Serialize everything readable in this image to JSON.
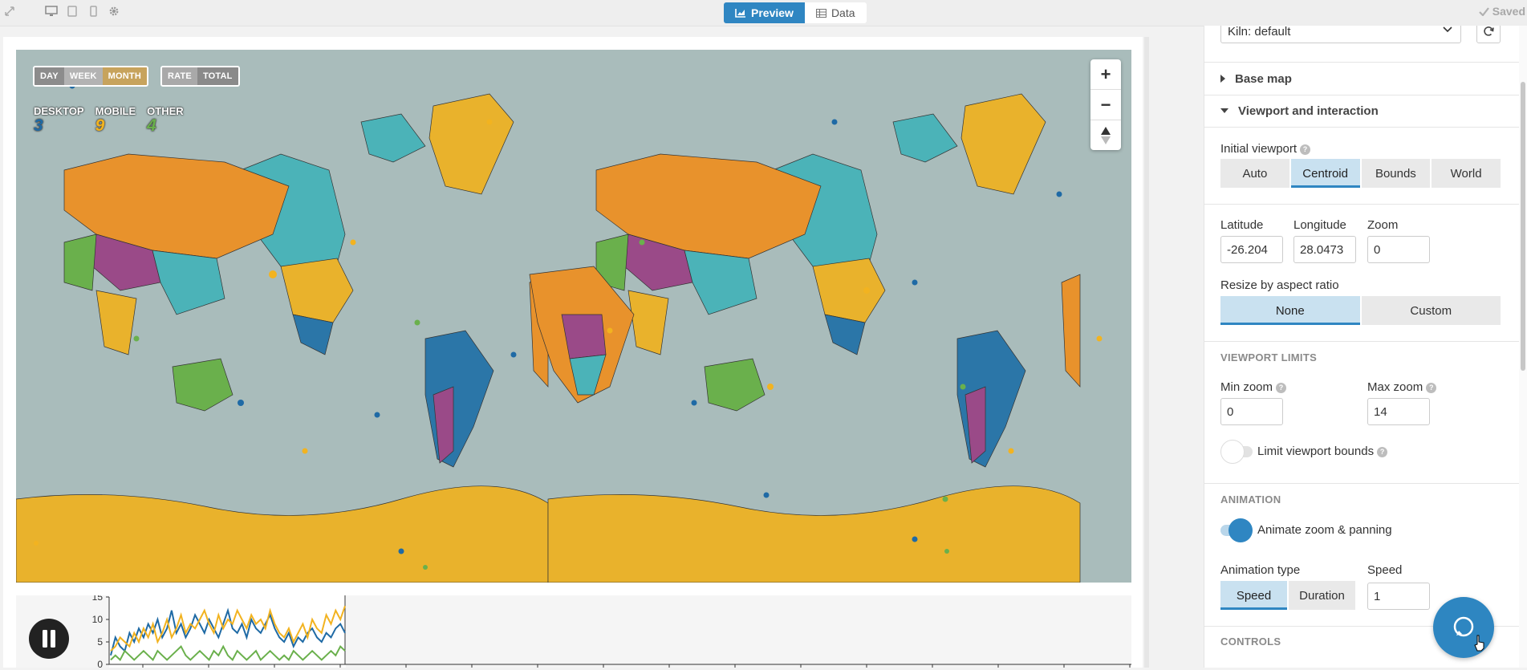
{
  "topbar": {
    "tabs": [
      {
        "label": "Preview",
        "icon": "chart-icon",
        "active": true
      },
      {
        "label": "Data",
        "icon": "table-icon",
        "active": false
      }
    ],
    "saved_label": "Saved"
  },
  "map": {
    "time_buttons": [
      "DAY",
      "WEEK",
      "MONTH"
    ],
    "mode_buttons": [
      "RATE",
      "TOTAL"
    ],
    "legend": [
      {
        "label": "DESKTOP",
        "value": "3",
        "color": "#1f6aa5"
      },
      {
        "label": "MOBILE",
        "value": "9",
        "color": "#f2b320"
      },
      {
        "label": "OTHER",
        "value": "4",
        "color": "#6ab04c"
      }
    ],
    "zoom_in": "+",
    "zoom_out": "−"
  },
  "timeline": {
    "y_ticks": [
      "15",
      "10",
      "5",
      "0"
    ],
    "series": [
      {
        "name": "DESKTOP",
        "color": "#1f6aa5",
        "values": [
          2,
          6,
          4,
          3,
          7,
          5,
          8,
          6,
          9,
          7,
          10,
          6,
          8,
          12,
          7,
          9,
          6,
          8,
          11,
          9,
          7,
          10,
          8,
          6,
          9,
          12,
          8,
          7,
          9,
          6,
          10,
          8,
          7,
          9,
          11,
          8,
          6,
          5,
          7,
          4,
          6,
          5,
          7,
          8,
          6,
          5,
          7,
          6,
          8,
          9,
          7
        ]
      },
      {
        "name": "MOBILE",
        "color": "#f2b320",
        "values": [
          3,
          4,
          6,
          5,
          4,
          7,
          5,
          8,
          6,
          9,
          5,
          7,
          10,
          6,
          8,
          11,
          7,
          9,
          8,
          10,
          12,
          9,
          7,
          11,
          8,
          10,
          9,
          12,
          10,
          8,
          11,
          9,
          10,
          8,
          12,
          9,
          7,
          6,
          8,
          5,
          7,
          9,
          6,
          10,
          8,
          7,
          11,
          9,
          12,
          10,
          13
        ]
      },
      {
        "name": "OTHER",
        "color": "#6ab04c",
        "values": [
          1,
          2,
          1,
          3,
          2,
          1,
          2,
          3,
          2,
          1,
          3,
          2,
          1,
          2,
          3,
          4,
          2,
          1,
          2,
          3,
          2,
          1,
          3,
          2,
          4,
          2,
          1,
          3,
          2,
          1,
          2,
          3,
          1,
          2,
          3,
          2,
          1,
          2,
          1,
          3,
          2,
          1,
          2,
          3,
          2,
          1,
          2,
          3,
          2,
          4,
          3
        ]
      }
    ]
  },
  "panel": {
    "template_select": "Kiln: default",
    "section_basemap": "Base map",
    "section_viewport": "Viewport and interaction",
    "initial_viewport_label": "Initial viewport",
    "viewport_options": [
      "Auto",
      "Centroid",
      "Bounds",
      "World"
    ],
    "viewport_selected": "Centroid",
    "latitude_label": "Latitude",
    "latitude_value": "-26.204",
    "longitude_label": "Longitude",
    "longitude_value": "28.0473",
    "zoom_label": "Zoom",
    "zoom_value": "0",
    "resize_label": "Resize by aspect ratio",
    "resize_options": [
      "None",
      "Custom"
    ],
    "resize_selected": "None",
    "limits_heading": "VIEWPORT LIMITS",
    "min_zoom_label": "Min zoom",
    "min_zoom_value": "0",
    "max_zoom_label": "Max zoom",
    "max_zoom_value": "14",
    "limit_bounds_label": "Limit viewport bounds",
    "limit_bounds_on": false,
    "animation_heading": "ANIMATION",
    "animate_label": "Animate zoom & panning",
    "animate_on": true,
    "animation_type_label": "Animation type",
    "animation_types": [
      "Speed",
      "Duration"
    ],
    "animation_type_selected": "Speed",
    "speed_label": "Speed",
    "speed_value": "1",
    "controls_heading": "CONTROLS"
  },
  "colors": {
    "accent": "#2f86c2",
    "ocean": "#a9bcbb",
    "land_yellow": "#e9b22c",
    "land_orange": "#e8922c",
    "land_teal": "#4bb3b8",
    "land_blue": "#2b76a8",
    "land_purple": "#9a4a88",
    "land_green": "#6ab04c"
  }
}
